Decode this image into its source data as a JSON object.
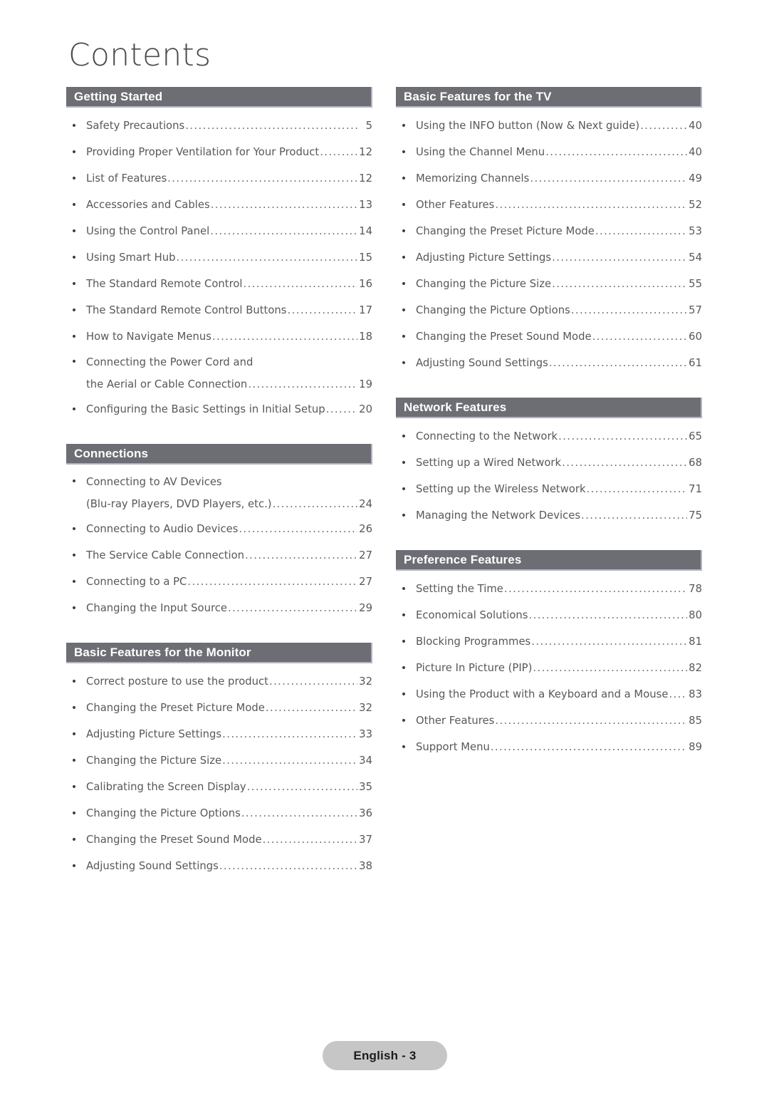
{
  "document": {
    "title": "Contents",
    "bullet_glyph": "•",
    "leader_char": ".",
    "accent_color": "#6d6e74",
    "text_color": "#58585b",
    "bar_edge_color": "#b3b3c4",
    "footer_badge_color": "#c6c6c6"
  },
  "columns": {
    "left": [
      {
        "heading": "Getting Started",
        "entries": [
          {
            "label": "Safety Precautions",
            "page": "5"
          },
          {
            "label": "Providing Proper Ventilation for Your Product",
            "page": "12"
          },
          {
            "label": "List of Features",
            "page": "12"
          },
          {
            "label": "Accessories and Cables",
            "page": "13"
          },
          {
            "label": "Using the Control Panel",
            "page": "14"
          },
          {
            "label": "Using Smart Hub",
            "page": "15"
          },
          {
            "label": "The Standard Remote Control",
            "page": "16"
          },
          {
            "label": "The Standard Remote Control Buttons",
            "page": "17"
          },
          {
            "label": "How to Navigate Menus",
            "page": "18"
          },
          {
            "label": "Connecting the Power Cord and",
            "label2": "the Aerial or Cable Connection",
            "page": "19",
            "multiline": true
          },
          {
            "label": "Configuring the Basic Settings in Initial Setup",
            "page": "20"
          }
        ]
      },
      {
        "heading": "Connections",
        "entries": [
          {
            "label": "Connecting to AV Devices",
            "label2": "(Blu-ray Players, DVD Players, etc.)",
            "page": "24",
            "multiline": true
          },
          {
            "label": "Connecting to Audio Devices",
            "page": "26"
          },
          {
            "label": "The Service Cable Connection ",
            "page": "27"
          },
          {
            "label": "Connecting to a PC",
            "page": "27"
          },
          {
            "label": "Changing the Input Source",
            "page": "29"
          }
        ]
      },
      {
        "heading": "Basic Features for the Monitor",
        "entries": [
          {
            "label": "Correct posture to use the product",
            "page": "32"
          },
          {
            "label": "Changing the Preset Picture Mode",
            "page": "32"
          },
          {
            "label": "Adjusting Picture Settings",
            "page": "33"
          },
          {
            "label": "Changing the Picture Size",
            "page": "34"
          },
          {
            "label": "Calibrating the Screen Display",
            "page": "35"
          },
          {
            "label": "Changing the Picture Options",
            "page": "36"
          },
          {
            "label": "Changing the Preset Sound Mode",
            "page": "37"
          },
          {
            "label": "Adjusting Sound Settings",
            "page": "38"
          }
        ]
      }
    ],
    "right": [
      {
        "heading": "Basic Features for the TV",
        "entries": [
          {
            "label": "Using the INFO button (Now & Next guide)",
            "page": "40"
          },
          {
            "label": "Using the Channel Menu",
            "page": "40"
          },
          {
            "label": "Memorizing Channels",
            "page": "49"
          },
          {
            "label": "Other Features",
            "page": "52"
          },
          {
            "label": "Changing the Preset Picture Mode",
            "page": "53"
          },
          {
            "label": "Adjusting Picture Settings",
            "page": "54"
          },
          {
            "label": "Changing the Picture Size",
            "page": "55"
          },
          {
            "label": "Changing the Picture Options",
            "page": "57"
          },
          {
            "label": "Changing the Preset Sound Mode",
            "page": "60"
          },
          {
            "label": "Adjusting Sound Settings",
            "page": "61"
          }
        ]
      },
      {
        "heading": "Network Features",
        "entries": [
          {
            "label": "Connecting to the Network",
            "page": "65"
          },
          {
            "label": "Setting up a Wired Network",
            "page": "68"
          },
          {
            "label": "Setting up the Wireless Network",
            "page": "71"
          },
          {
            "label": "Managing the Network Devices",
            "page": "75"
          }
        ]
      },
      {
        "heading": "Preference Features",
        "entries": [
          {
            "label": "Setting the Time",
            "page": "78"
          },
          {
            "label": "Economical Solutions",
            "page": "80"
          },
          {
            "label": "Blocking Programmes",
            "page": "81"
          },
          {
            "label": "Picture In Picture (PIP)",
            "page": "82"
          },
          {
            "label": "Using the Product with a Keyboard and a Mouse",
            "page": "83"
          },
          {
            "label": "Other Features",
            "page": "85"
          },
          {
            "label": "Support Menu",
            "page": "89"
          }
        ]
      }
    ]
  },
  "footer": {
    "label": "English - 3"
  }
}
